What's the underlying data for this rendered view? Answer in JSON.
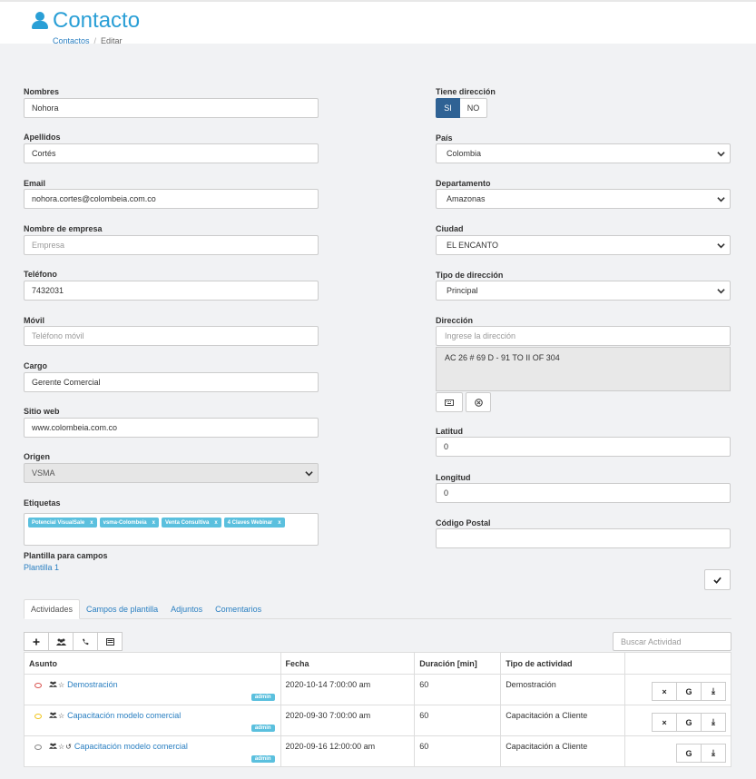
{
  "header": {
    "title": "Contacto",
    "breadcrumb": {
      "parent": "Contactos",
      "current": "Editar"
    }
  },
  "left_fields": {
    "nombres": {
      "label": "Nombres",
      "value": "Nohora"
    },
    "apellidos": {
      "label": "Apellidos",
      "value": "Cortés"
    },
    "email": {
      "label": "Email",
      "value": "nohora.cortes@colombeia.com.co"
    },
    "empresa": {
      "label": "Nombre de empresa",
      "placeholder": "Empresa"
    },
    "telefono": {
      "label": "Teléfono",
      "value": "7432031"
    },
    "movil": {
      "label": "Móvil",
      "placeholder": "Teléfono móvil"
    },
    "cargo": {
      "label": "Cargo",
      "value": "Gerente Comercial"
    },
    "sitio": {
      "label": "Sitio web",
      "value": "www.colombeia.com.co"
    },
    "origen": {
      "label": "Origen",
      "value": "VSMA"
    },
    "etiquetas": {
      "label": "Etiquetas",
      "tags": [
        "Potencial VisualSale",
        "vsma-Colombeia",
        "Venta Consultiva",
        "4 Claves Webinar"
      ],
      "remove": "x"
    },
    "plantilla": {
      "label": "Plantilla para campos",
      "link": "Plantilla 1"
    }
  },
  "right_fields": {
    "tiene_direccion": {
      "label": "Tiene dirección",
      "yes": "SI",
      "no": "NO"
    },
    "pais": {
      "label": "País",
      "value": "Colombia"
    },
    "departamento": {
      "label": "Departamento",
      "value": "Amazonas"
    },
    "ciudad": {
      "label": "Ciudad",
      "value": "EL ENCANTO"
    },
    "tipo_direccion": {
      "label": "Tipo de dirección",
      "value": "Principal"
    },
    "direccion": {
      "label": "Dirección",
      "placeholder": "Ingrese la dirección",
      "text": "AC 26 # 69 D - 91 TO II OF 304"
    },
    "latitud": {
      "label": "Latitud",
      "value": "0"
    },
    "longitud": {
      "label": "Longitud",
      "value": "0"
    },
    "codigo_postal": {
      "label": "Código Postal",
      "value": ""
    }
  },
  "tabs": [
    "Actividades",
    "Campos de plantilla",
    "Adjuntos",
    "Comentarios"
  ],
  "search": {
    "placeholder": "Buscar Actividad"
  },
  "table": {
    "headers": [
      "Asunto",
      "Fecha",
      "Duración [min]",
      "Tipo de actividad",
      ""
    ],
    "rows": [
      {
        "subject": "Demostración",
        "owner": "admin",
        "date": "2020-10-14 7:00:00 am",
        "duration": "60",
        "type": "Demostración",
        "status_color": "#d9534f"
      },
      {
        "subject": "Capacitación modelo comercial",
        "owner": "admin",
        "date": "2020-09-30 7:00:00 am",
        "duration": "60",
        "type": "Capacitación a Cliente",
        "status_color": "#f0c419"
      },
      {
        "subject": "Capacitación modelo comercial",
        "owner": "admin",
        "date": "2020-09-16 12:00:00 am",
        "duration": "60",
        "type": "Capacitación a Cliente",
        "status_color": "#888888"
      }
    ],
    "action_labels": {
      "delete": "×",
      "google": "G",
      "download": "⤓"
    }
  },
  "colors": {
    "accent": "#2a9fd6",
    "link": "#2a7fc1",
    "tag": "#5bc0de",
    "toggle_on": "#2f6294"
  }
}
